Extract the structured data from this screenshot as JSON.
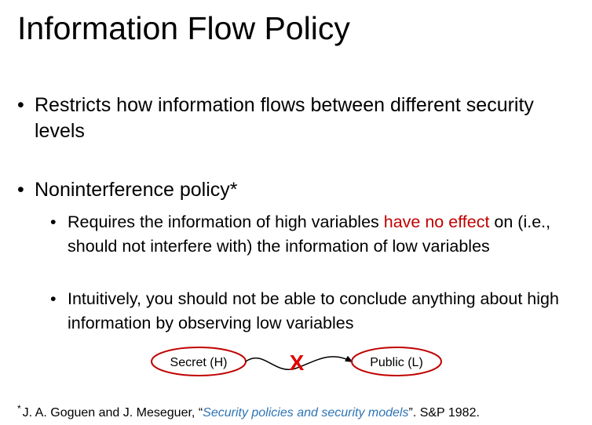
{
  "slide": {
    "title": "Information Flow Policy",
    "bullets": [
      {
        "marker": "•",
        "text": "Restricts how information flows between different security levels"
      },
      {
        "marker": "•",
        "text": "Noninterference policy*",
        "sub_bullets": [
          {
            "marker": "•",
            "text_before": "Requires the information of high variables ",
            "text_highlight": "have no effect",
            "text_after": " on (i.e., should not interfere with) the information of low variables"
          },
          {
            "marker": "•",
            "text": "Intuitively, you should not be able to conclude anything about high information by observing low variables"
          }
        ]
      }
    ]
  },
  "diagram": {
    "source_node": "Secret (H)",
    "target_node": "Public (L)",
    "block_mark": "X"
  },
  "footnote": {
    "marker": "*",
    "authors": "J. A. Goguen and J. Meseguer, “",
    "paper_title": "Security policies and security models",
    "venue": "”. S&P 1982."
  },
  "colors": {
    "highlight": "#c00000",
    "diagram_red": "#c00000",
    "block_mark": "#e00000",
    "citation_link": "#2e74b5"
  }
}
